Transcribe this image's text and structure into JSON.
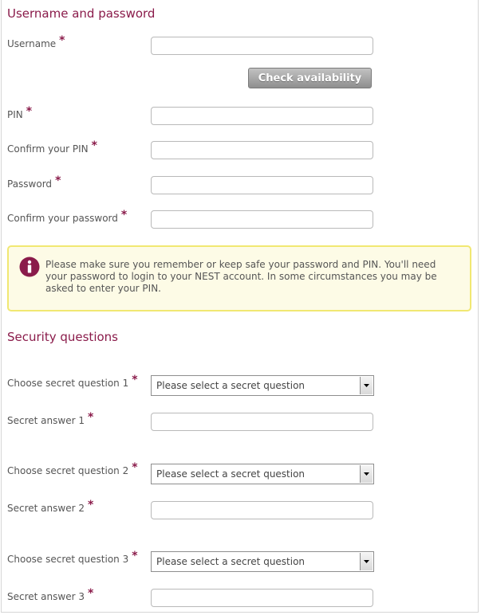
{
  "sections": {
    "credentials_title": "Username and password",
    "security_title": "Security questions"
  },
  "fields": {
    "username_label": "Username",
    "pin_label": "PIN",
    "confirm_pin_label": "Confirm your PIN",
    "password_label": "Password",
    "confirm_password_label": "Confirm your password",
    "q1_label": "Choose secret question 1",
    "a1_label": "Secret answer 1",
    "q2_label": "Choose secret question 2",
    "a2_label": "Secret answer 2",
    "q3_label": "Choose secret question 3",
    "a3_label": "Secret answer 3"
  },
  "required_marker": "*",
  "check_button_label": "Check availability",
  "info_message": "Please make sure you remember or keep safe your password and PIN. You'll need your password to login to your NEST account. In some circumstances you may be asked to enter your PIN.",
  "select_placeholder": "Please select a secret question",
  "icons": {
    "info": "info-icon",
    "dropdown": "chevron-down-icon"
  },
  "colors": {
    "heading": "#8a1b4a",
    "required": "#8a1b4a",
    "info_bg": "#fdfbe6",
    "info_border": "#f1e872",
    "info_icon": "#8a1b4a"
  }
}
